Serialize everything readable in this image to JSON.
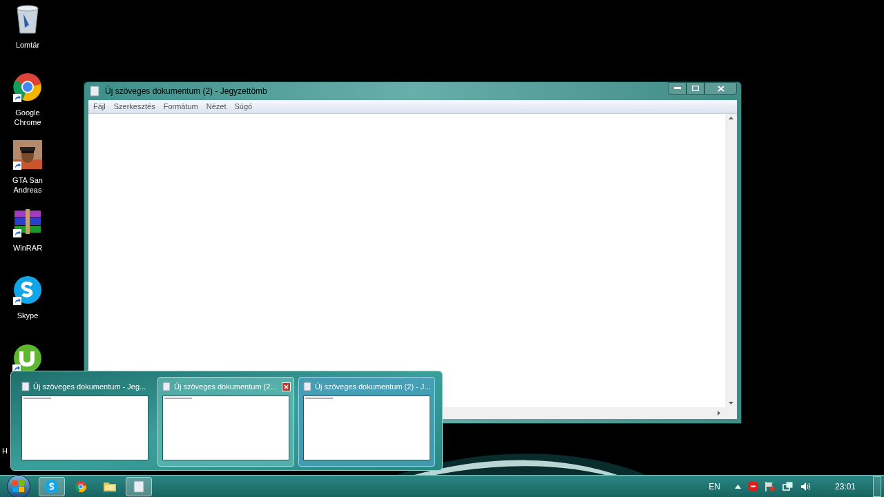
{
  "desktop_icons": [
    {
      "kind": "recycle",
      "label": "Lomtár",
      "shortcut": false
    },
    {
      "kind": "chrome",
      "label": "Google Chrome",
      "shortcut": true
    },
    {
      "kind": "game",
      "label": "GTA San Andreas",
      "shortcut": true
    },
    {
      "kind": "winrar",
      "label": "WinRAR",
      "shortcut": true
    },
    {
      "kind": "skype",
      "label": "Skype",
      "shortcut": true
    },
    {
      "kind": "utorrent",
      "label": "H",
      "shortcut": true
    }
  ],
  "window": {
    "title": "Új szöveges dokumentum (2) - Jegyzettömb",
    "menu": [
      "Fájl",
      "Szerkesztés",
      "Formátum",
      "Nézet",
      "Súgó"
    ]
  },
  "thumbnails": [
    {
      "title": "Új szöveges dokumentum - Jeg...",
      "hovered": false,
      "selected": false
    },
    {
      "title": "Új szöveges dokumentum (2...",
      "hovered": true,
      "selected": false
    },
    {
      "title": "Új szöveges dokumentum (2) - J...",
      "hovered": false,
      "selected": true
    }
  ],
  "taskbar": {
    "items": [
      {
        "kind": "skype",
        "active": true
      },
      {
        "kind": "chrome",
        "active": false
      },
      {
        "kind": "folder",
        "active": false
      },
      {
        "kind": "notepad",
        "active": true
      }
    ],
    "language": "EN",
    "clock": "23:01"
  }
}
